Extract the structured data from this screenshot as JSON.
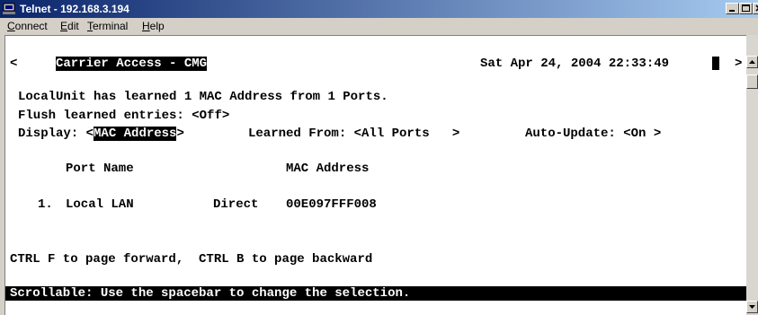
{
  "window": {
    "title": "Telnet - 192.168.3.194"
  },
  "menu": {
    "items": [
      "Connect",
      "Edit",
      "Terminal",
      "Help"
    ]
  },
  "terminal": {
    "back_arrow": "<",
    "header_title": "Carrier Access - CMG",
    "datetime": "Sat Apr 24, 2004 22:33:49",
    "forward_arrow": ">",
    "learned_line": "LocalUnit has learned 1 MAC Address from 1 Ports.",
    "flush_label": "Flush learned entries: ",
    "flush_value": "<Off>",
    "display_label": "Display: ",
    "display_open": "<",
    "display_value": "MAC Address",
    "display_close": ">",
    "learned_from_label": "Learned From: ",
    "learned_from_value": "<All Ports   >",
    "auto_update_label": "Auto-Update: ",
    "auto_update_value": "<On >",
    "col_port_name": "Port Name",
    "col_mac_address": "MAC Address",
    "rows": [
      {
        "index": "1.",
        "port_name": "Local LAN",
        "type": "Direct",
        "mac": "00E097FFF008"
      }
    ],
    "paging_hint": "CTRL F to page forward,  CTRL B to page backward",
    "status_line": "Scrollable: Use the spacebar to change the selection."
  }
}
